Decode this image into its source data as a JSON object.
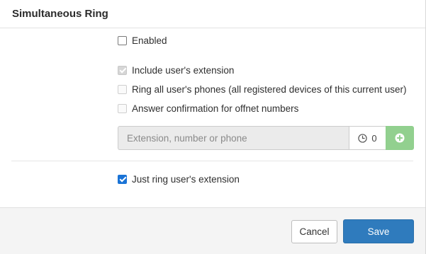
{
  "dialog": {
    "title": "Simultaneous Ring"
  },
  "options": {
    "enabled": {
      "label": "Enabled",
      "checked": false,
      "disabled": false
    },
    "include_user_extension": {
      "label": "Include user's extension",
      "checked": true,
      "disabled": true
    },
    "ring_all_phones": {
      "label": "Ring all user's phones (all registered devices of this current user)",
      "checked": false,
      "disabled": true
    },
    "answer_confirmation": {
      "label": "Answer confirmation for offnet numbers",
      "checked": false,
      "disabled": true
    },
    "just_ring_extension": {
      "label": "Just ring user's extension",
      "checked": true,
      "disabled": false
    }
  },
  "destination": {
    "placeholder": "Extension, number or phone",
    "value": "",
    "timeout_value": "0",
    "timeout_icon": "clock-icon",
    "add_icon": "plus-circle-icon"
  },
  "footer": {
    "cancel_label": "Cancel",
    "save_label": "Save"
  },
  "colors": {
    "primary": "#2f7bbd",
    "add_button": "#92d08f",
    "checkbox_checked": "#1a73d6",
    "footer_bg": "#f4f4f4"
  }
}
